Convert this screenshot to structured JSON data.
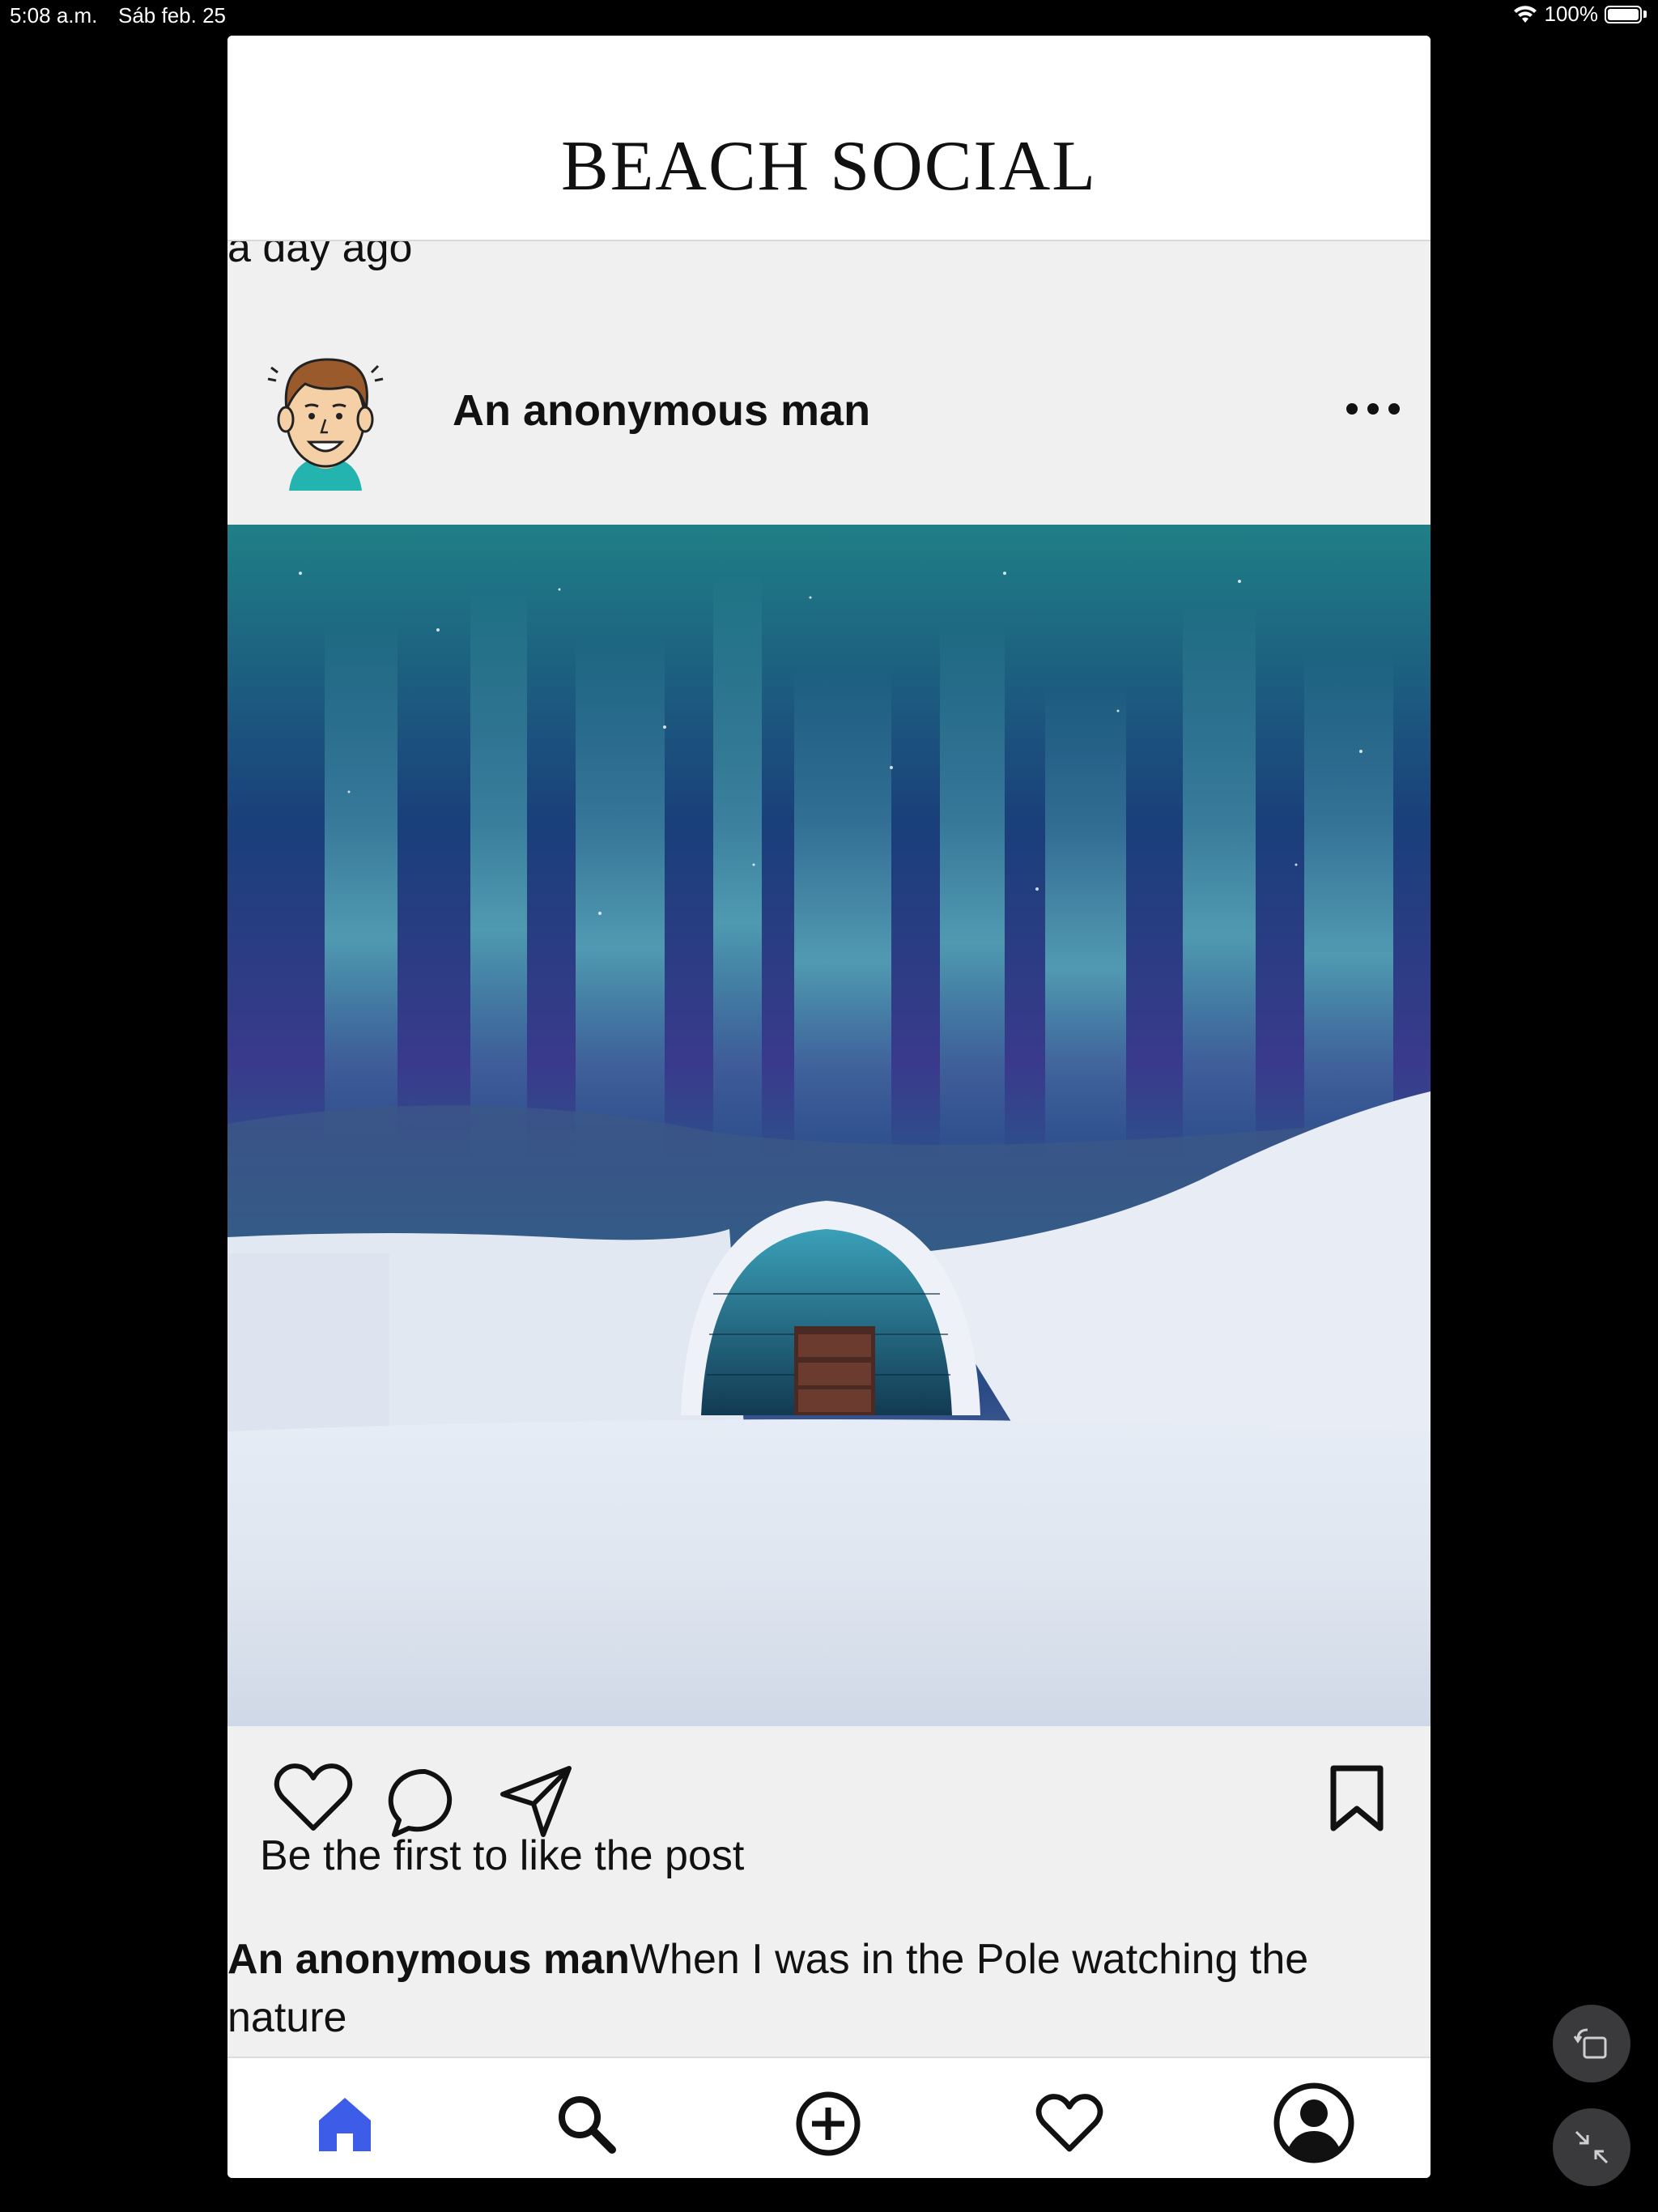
{
  "status_bar": {
    "time": "5:08 a.m.",
    "date": "Sáb feb. 25",
    "battery": "100%"
  },
  "app": {
    "title": "BEACH SOCIAL"
  },
  "feed": {
    "previous_post_time": "a day ago",
    "post": {
      "username": "An anonymous man",
      "likes_text": "Be the first to like the post",
      "caption_user": "An anonymous man",
      "caption_text": "When I was in the Pole watching the nature",
      "image_description_icon": "aurora-igloo-photo"
    }
  },
  "bottom_nav": {
    "items": [
      {
        "name": "home",
        "icon": "home-icon",
        "active": true
      },
      {
        "name": "search",
        "icon": "search-icon",
        "active": false
      },
      {
        "name": "add",
        "icon": "add-circle-icon",
        "active": false
      },
      {
        "name": "activity",
        "icon": "heart-icon",
        "active": false
      },
      {
        "name": "profile",
        "icon": "profile-icon",
        "active": false
      }
    ]
  },
  "colors": {
    "accent": "#3d5ce8",
    "background": "#f0f0f0",
    "header": "#ffffff"
  }
}
